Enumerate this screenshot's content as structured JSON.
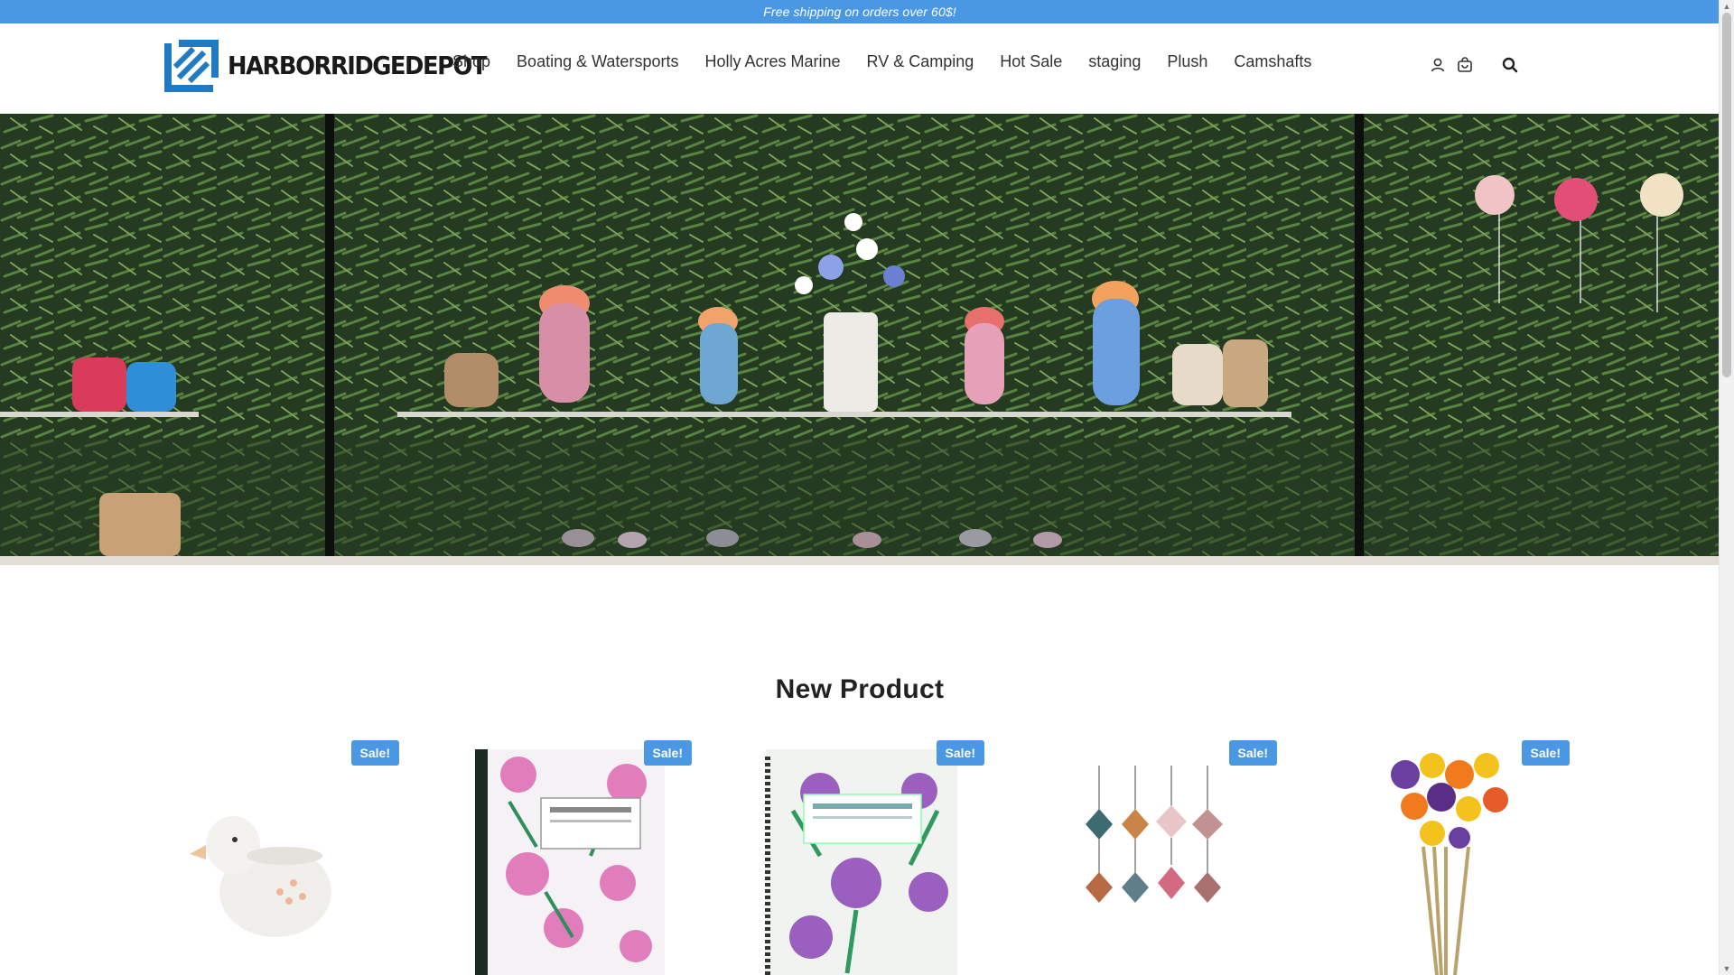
{
  "announcement": {
    "text": "Free shipping on orders over 60$!"
  },
  "brand": {
    "name": "HARBORRIDGEDEPOT"
  },
  "nav": {
    "items": [
      {
        "label": "Shop"
      },
      {
        "label": "Boating & Watersports"
      },
      {
        "label": "Holly Acres Marine"
      },
      {
        "label": "RV & Camping"
      },
      {
        "label": "Hot Sale"
      },
      {
        "label": "staging"
      },
      {
        "label": "Plush"
      },
      {
        "label": "Camshafts"
      }
    ]
  },
  "header_icons": [
    "user-icon",
    "cart-icon",
    "search-icon"
  ],
  "section": {
    "title": "New Product"
  },
  "products": [
    {
      "badge": "Sale!",
      "image": "duck planter"
    },
    {
      "badge": "Sale!",
      "image": "pink floral decomposition book"
    },
    {
      "badge": "Sale!",
      "image": "purple floral spiral decomposition book"
    },
    {
      "badge": "Sale!",
      "image": "glass ornaments set"
    },
    {
      "badge": "Sale!",
      "image": "dried flower bouquet"
    }
  ],
  "colors": {
    "accent": "#4a97e4",
    "text": "#333333",
    "title": "#222222"
  }
}
